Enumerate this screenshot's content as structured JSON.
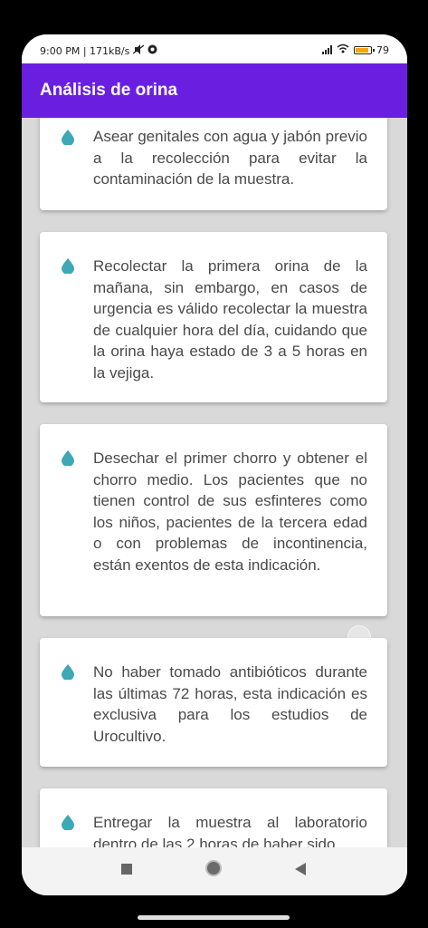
{
  "status_bar": {
    "left_text": "9:00 PM | 171kB/s",
    "battery": "79"
  },
  "app_bar": {
    "title": "Análisis de orina"
  },
  "instructions": [
    {
      "text": "Asear genitales con agua y jabón previo a la recolección para evitar la contaminación de la muestra."
    },
    {
      "text": "Recolectar la primera orina de la mañana, sin embargo, en casos de urgencia es válido recolectar la muestra de cualquier hora del día, cuidando que la orina haya estado de 3 a 5 horas en la vejiga."
    },
    {
      "text": "Desechar el primer chorro y obtener el chorro medio. Los pacientes que no tienen control de sus esfinteres como los niños, pacientes de la tercera edad o con problemas de incontinencia, están exentos de esta indicación."
    },
    {
      "text": "No haber tomado antibióticos durante las últimas 72 horas, esta indicación es exclusiva para los estudios de Urocultivo."
    },
    {
      "text": "Entregar la muestra al laboratorio dentro de las 2 horas de haber sido"
    }
  ],
  "icons": {
    "bullet": "water-drop-icon",
    "drop_color": "#3fa7b5",
    "accent": "#6a1fe0"
  }
}
